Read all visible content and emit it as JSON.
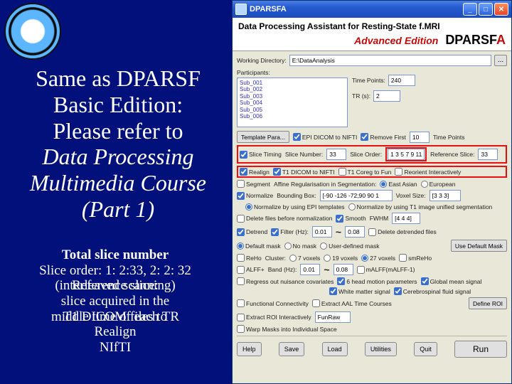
{
  "slide": {
    "heading_l1": "Same as DPARSF",
    "heading_l2": "Basic Edition:",
    "heading_l3": "Please refer to",
    "heading_l4a": "Data Processing",
    "heading_l4b": "Multimedia Course",
    "heading_l4c": "(Part 1)",
    "note_l1": "Total slice number",
    "note_l2": "Slice order: 1: 2:33, 2: 2: 32",
    "note_l3": "(interleaved scanning)",
    "note_l3_over": "Reference slice:",
    "note_l4": "slice acquired in the",
    "note_l5": "middle time of each TR",
    "note_l5_over": "T1 DICOM files to",
    "note_l6": "Realign",
    "note_l7": "NIfTI"
  },
  "win": {
    "title": "DPARSFA",
    "header_line": "Data Processing Assistant for Resting-State f.MRI",
    "header_adv": "Advanced Edition",
    "header_name_root": "DPARSF",
    "header_name_tail": "A",
    "fields": {
      "working_dir_lbl": "Working Directory:",
      "working_dir_val": "E:\\DataAnalysis",
      "browse": "...",
      "participants_lbl": "Participants:",
      "time_points_lbl": "Time Points:",
      "time_points_val": "240",
      "tr_lbl": "TR (s):",
      "tr_val": "2",
      "template_para_lbl": "Template Para...",
      "epi2nifti": "EPI DICOM to NIFTI",
      "remove_first": "Remove First",
      "remove_first_val": "10",
      "remove_first_suffix": "Time Points",
      "slice_timing": "Slice Timing",
      "slice_number_lbl": "Slice Number:",
      "slice_number_val": "33",
      "slice_order_lbl": "Slice Order:",
      "slice_order_val": "1 3 5 7 9 11",
      "ref_slice_lbl": "Reference Slice:",
      "ref_slice_val": "33",
      "realign": "Realign",
      "t1_dicom": "T1 DICOM to NIFTI",
      "t1_coreg": "T1 Coreg to Fun",
      "reorient_int": "Reorient Interactively",
      "segment": "Segment",
      "affine_reg_lbl": "Affine Regularisation in Segmentation:",
      "east_asian": "East Asian",
      "european": "European",
      "normalize": "Normalize",
      "bbox_lbl": "Bounding Box:",
      "bbox_val": "[-90 -126 -72;90 90 1",
      "voxel_lbl": "Voxel Size:",
      "voxel_val": "[3 3 3]",
      "norm_epi": "Normalize by using EPI templates",
      "norm_t1": "Normalize by using T1 image unified segmentation",
      "delete_before": "Delete files before normalization",
      "smooth": "Smooth",
      "fwhm_lbl": "FWHM",
      "fwhm_val": "[4 4 4]",
      "detrend": "Detrend",
      "filter": "Filter (Hz):",
      "filter_lo": "0.01",
      "filter_hi": "0.08",
      "delete_detrended": "Delete detrended files",
      "default_mask": "Default mask",
      "no_mask": "No mask",
      "user_mask": "User-defined mask",
      "use_default_mask_btn": "Use Default Mask",
      "reho": "ReHo",
      "cluster_lbl": "Cluster:",
      "c7": "7 voxels",
      "c19": "19 voxels",
      "c27": "27 voxels",
      "smreho": "smReHo",
      "alff": "ALFF+",
      "band_lbl": "Band (Hz):",
      "band_lo": "0.01",
      "band_hi": "0.08",
      "malff": "mALFF(mALFF-1)",
      "regress_cov": "Regress out nuisance covariates",
      "head_motion": "6 head motion parameters",
      "global_signal": "Global mean signal",
      "wm_signal": "White matter signal",
      "csf_signal": "Cerebrospinal fluid signal",
      "func_conn": "Functional Connectivity",
      "extract_aal": "Extract AAL Time Courses",
      "define_roi_btn": "Define ROI",
      "extract_interact": "Extract ROI Interactively",
      "warp_masks": "Warp Masks into Individual Space",
      "fun_raw": "FunRaw"
    },
    "participants": [
      "Sub_001",
      "Sub_002",
      "Sub_003",
      "Sub_004",
      "Sub_005",
      "Sub_006"
    ],
    "footer": {
      "help": "Help",
      "save": "Save",
      "load": "Load",
      "utilities": "Utilities",
      "quit": "Quit",
      "run": "Run"
    }
  }
}
